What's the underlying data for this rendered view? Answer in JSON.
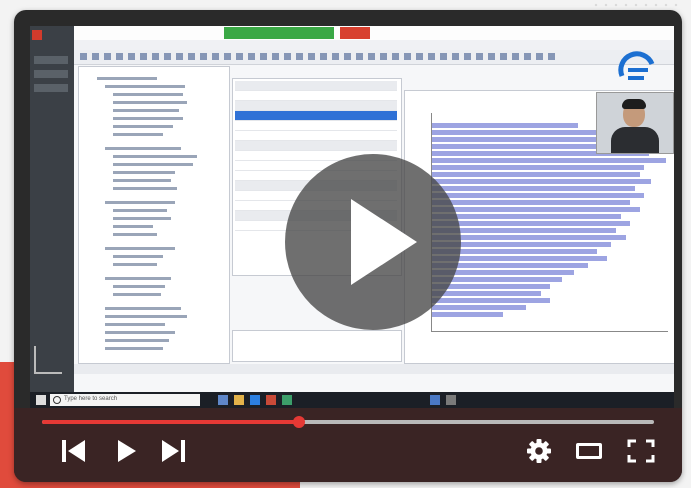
{
  "colors": {
    "progress_fill": "#e53935",
    "controls_bg": "#3a2424",
    "accent_red": "#e04b3c"
  },
  "desktop": {
    "taskbar": {
      "search_placeholder": "Type here to search"
    }
  },
  "player": {
    "progress": 0.42,
    "overlay_icon": "play-icon",
    "controls": {
      "prev_icon": "skip-previous-icon",
      "play_icon": "play-icon",
      "next_icon": "skip-next-icon",
      "settings_icon": "gear-icon",
      "theater_icon": "theater-mode-icon",
      "fullscreen_icon": "fullscreen-icon"
    }
  }
}
